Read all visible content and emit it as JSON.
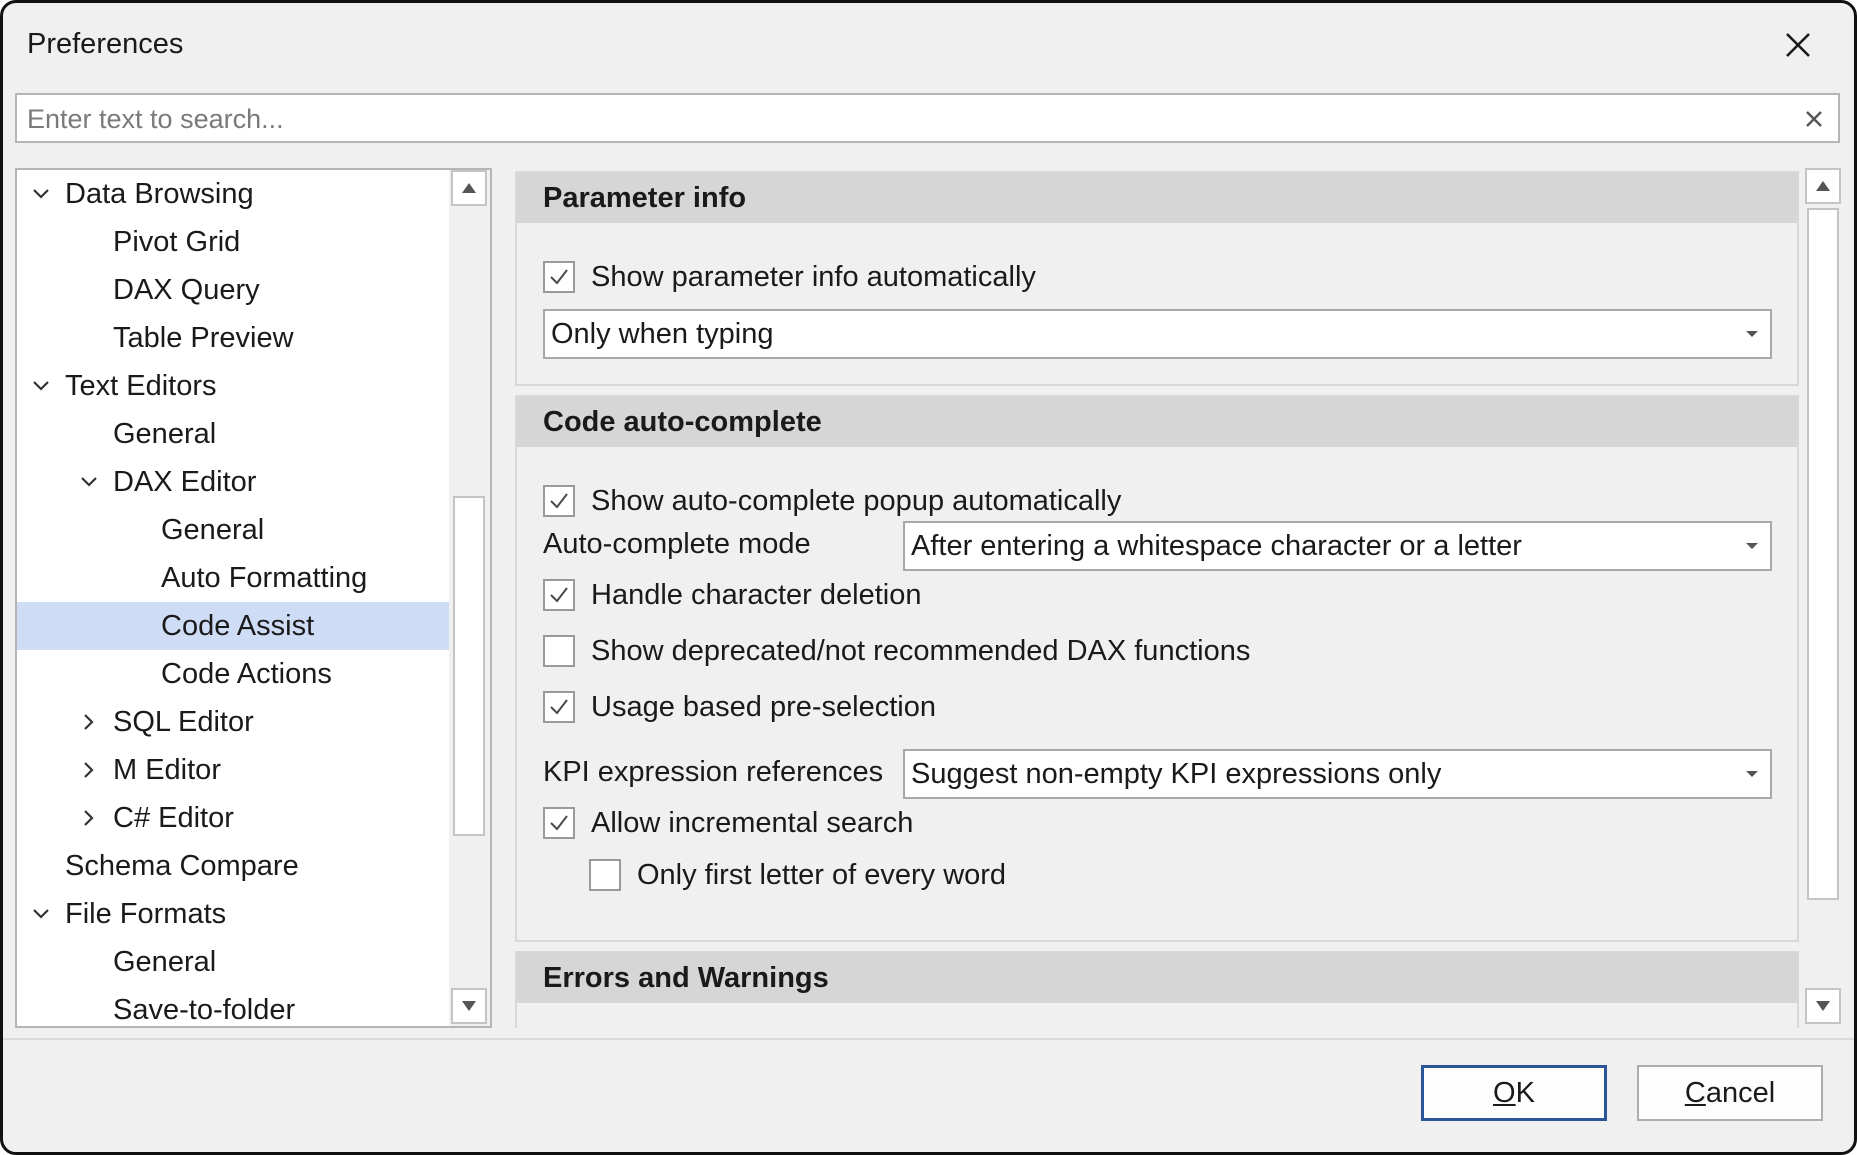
{
  "window": {
    "title": "Preferences"
  },
  "search": {
    "placeholder": "Enter text to search..."
  },
  "tree": [
    {
      "label": "Data Browsing",
      "level": 0,
      "expander": "expanded"
    },
    {
      "label": "Pivot Grid",
      "level": 1,
      "expander": "none"
    },
    {
      "label": "DAX Query",
      "level": 1,
      "expander": "none"
    },
    {
      "label": "Table Preview",
      "level": 1,
      "expander": "none"
    },
    {
      "label": "Text Editors",
      "level": 0,
      "expander": "expanded"
    },
    {
      "label": "General",
      "level": 1,
      "expander": "none"
    },
    {
      "label": "DAX Editor",
      "level": 1,
      "expander": "expanded"
    },
    {
      "label": "General",
      "level": 2,
      "expander": "none"
    },
    {
      "label": "Auto Formatting",
      "level": 2,
      "expander": "none"
    },
    {
      "label": "Code Assist",
      "level": 2,
      "expander": "none",
      "selected": true
    },
    {
      "label": "Code Actions",
      "level": 2,
      "expander": "none"
    },
    {
      "label": "SQL Editor",
      "level": 1,
      "expander": "collapsed"
    },
    {
      "label": "M Editor",
      "level": 1,
      "expander": "collapsed"
    },
    {
      "label": "C# Editor",
      "level": 1,
      "expander": "collapsed"
    },
    {
      "label": "Schema Compare",
      "level": 0,
      "expander": "none"
    },
    {
      "label": "File Formats",
      "level": 0,
      "expander": "expanded"
    },
    {
      "label": "General",
      "level": 1,
      "expander": "none"
    },
    {
      "label": "Save-to-folder",
      "level": 1,
      "expander": "none"
    }
  ],
  "parameter_info": {
    "header": "Parameter info",
    "show_auto": {
      "label": "Show parameter info automatically",
      "checked": true
    },
    "mode_value": "Only when typing"
  },
  "code_autocomplete": {
    "header": "Code auto-complete",
    "show_popup": {
      "label": "Show auto-complete popup automatically",
      "checked": true
    },
    "mode_label": "Auto-complete mode",
    "mode_value": "After entering a whitespace character or a letter",
    "handle_deletion": {
      "label": "Handle character deletion",
      "checked": true
    },
    "show_deprecated": {
      "label": "Show deprecated/not recommended DAX functions",
      "checked": false
    },
    "usage_preselection": {
      "label": "Usage based pre-selection",
      "checked": true
    },
    "kpi_label": "KPI expression references",
    "kpi_value": "Suggest non-empty KPI expressions only",
    "incremental_search": {
      "label": "Allow incremental search",
      "checked": true
    },
    "first_letter": {
      "label": "Only first letter of every word",
      "checked": false
    }
  },
  "errors_warnings": {
    "header": "Errors and Warnings"
  },
  "buttons": {
    "ok": {
      "accel": "O",
      "rest": "K"
    },
    "cancel": {
      "accel": "C",
      "rest": "ancel"
    }
  },
  "colors": {
    "selection": "#cfdcf5",
    "group_header": "#d6d6d6",
    "primary_border": "#2a5599",
    "checkmark": "#4a4a4a"
  },
  "icons": {
    "close": "close-icon",
    "search_clear": "clear-search-icon",
    "expanded": "chevron-down-icon",
    "collapsed": "chevron-right-icon",
    "dropdown": "dropdown-arrow-icon",
    "check": "checkmark-icon"
  }
}
